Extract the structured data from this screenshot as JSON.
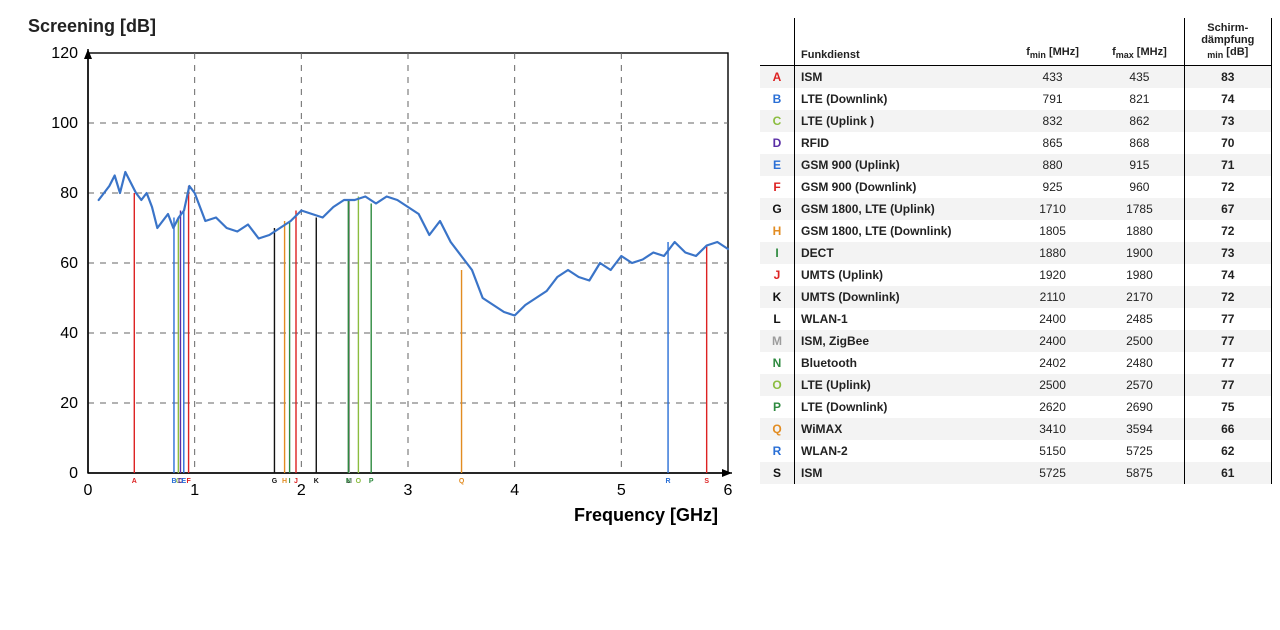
{
  "chart": {
    "y_title": "Screening [dB]",
    "x_title": "Frequency [GHz]",
    "x_min": 0,
    "x_max": 6,
    "y_min": 0,
    "y_max": 120,
    "x_ticks": [
      0,
      1,
      2,
      3,
      4,
      5,
      6
    ],
    "y_ticks": [
      0,
      20,
      40,
      60,
      80,
      100,
      120
    ]
  },
  "chart_data": {
    "type": "line",
    "title": "Screening [dB]",
    "xlabel": "Frequency [GHz]",
    "ylabel": "Screening [dB]",
    "xlim": [
      0,
      6
    ],
    "ylim": [
      0,
      120
    ],
    "series": [
      {
        "name": "Screening",
        "color": "#3a74c8",
        "x": [
          0.1,
          0.15,
          0.2,
          0.25,
          0.3,
          0.35,
          0.4,
          0.45,
          0.5,
          0.55,
          0.6,
          0.65,
          0.7,
          0.75,
          0.8,
          0.85,
          0.9,
          0.95,
          1.0,
          1.1,
          1.2,
          1.3,
          1.4,
          1.5,
          1.6,
          1.7,
          1.8,
          1.9,
          2.0,
          2.1,
          2.2,
          2.3,
          2.4,
          2.5,
          2.6,
          2.7,
          2.8,
          2.9,
          3.0,
          3.1,
          3.2,
          3.3,
          3.4,
          3.5,
          3.6,
          3.7,
          3.8,
          3.9,
          4.0,
          4.1,
          4.2,
          4.3,
          4.4,
          4.5,
          4.6,
          4.7,
          4.8,
          4.9,
          5.0,
          5.1,
          5.2,
          5.3,
          5.4,
          5.5,
          5.6,
          5.7,
          5.8,
          5.9,
          6.0
        ],
        "y": [
          78,
          80,
          82,
          85,
          80,
          86,
          83,
          80,
          78,
          80,
          76,
          70,
          72,
          74,
          70,
          73,
          75,
          82,
          80,
          72,
          73,
          70,
          69,
          71,
          67,
          68,
          70,
          72,
          75,
          74,
          73,
          76,
          78,
          78,
          79,
          77,
          79,
          78,
          76,
          74,
          68,
          72,
          66,
          62,
          58,
          50,
          48,
          46,
          45,
          48,
          50,
          52,
          56,
          58,
          56,
          55,
          60,
          58,
          62,
          60,
          61,
          63,
          62,
          66,
          63,
          62,
          65,
          66,
          64
        ]
      }
    ],
    "markers": [
      {
        "letter": "A",
        "ghz": 0.434,
        "color": "#d22"
      },
      {
        "letter": "B",
        "ghz": 0.806,
        "color": "#2a6fd6"
      },
      {
        "letter": "C",
        "ghz": 0.847,
        "color": "#8bbd3f"
      },
      {
        "letter": "D",
        "ghz": 0.867,
        "color": "#5a2ea6"
      },
      {
        "letter": "E",
        "ghz": 0.898,
        "color": "#2a6fd6"
      },
      {
        "letter": "F",
        "ghz": 0.943,
        "color": "#d22"
      },
      {
        "letter": "G",
        "ghz": 1.748,
        "color": "#111"
      },
      {
        "letter": "H",
        "ghz": 1.843,
        "color": "#e28c21"
      },
      {
        "letter": "I",
        "ghz": 1.89,
        "color": "#2e8a3f"
      },
      {
        "letter": "J",
        "ghz": 1.95,
        "color": "#d22"
      },
      {
        "letter": "K",
        "ghz": 2.14,
        "color": "#111"
      },
      {
        "letter": "L",
        "ghz": 2.443,
        "color": "#111"
      },
      {
        "letter": "M",
        "ghz": 2.45,
        "color": "#9c9c9c"
      },
      {
        "letter": "N",
        "ghz": 2.441,
        "color": "#2e8a3f"
      },
      {
        "letter": "O",
        "ghz": 2.535,
        "color": "#8bbd3f"
      },
      {
        "letter": "P",
        "ghz": 2.655,
        "color": "#2e8a3f"
      },
      {
        "letter": "Q",
        "ghz": 3.502,
        "color": "#e28c21"
      },
      {
        "letter": "R",
        "ghz": 5.438,
        "color": "#2a6fd6"
      },
      {
        "letter": "S",
        "ghz": 5.8,
        "color": "#d22"
      }
    ]
  },
  "table": {
    "headers": {
      "name": "Funkdienst",
      "fmin": "f<sub class=\"sub\">min</sub> [MHz]",
      "fmax": "f<sub class=\"sub\">max</sub> [MHz]",
      "att": "Schirm-<br>dämpfung<br><sub class=\"sub\">min</sub> [dB]"
    },
    "rows": [
      {
        "letter": "A",
        "color": "#d22",
        "name": "ISM",
        "fmin": 433,
        "fmax": 435,
        "att": 83
      },
      {
        "letter": "B",
        "color": "#2a6fd6",
        "name": "LTE (Downlink)",
        "fmin": 791,
        "fmax": 821,
        "att": 74
      },
      {
        "letter": "C",
        "color": "#8bbd3f",
        "name": "LTE (Uplink )",
        "fmin": 832,
        "fmax": 862,
        "att": 73
      },
      {
        "letter": "D",
        "color": "#5a2ea6",
        "name": "RFID",
        "fmin": 865,
        "fmax": 868,
        "att": 70
      },
      {
        "letter": "E",
        "color": "#2a6fd6",
        "name": "GSM 900 (Uplink)",
        "fmin": 880,
        "fmax": 915,
        "att": 71
      },
      {
        "letter": "F",
        "color": "#d22",
        "name": "GSM 900 (Downlink)",
        "fmin": 925,
        "fmax": 960,
        "att": 72
      },
      {
        "letter": "G",
        "color": "#111",
        "name": "GSM 1800, LTE (Uplink)",
        "fmin": 1710,
        "fmax": 1785,
        "att": 67
      },
      {
        "letter": "H",
        "color": "#e28c21",
        "name": "GSM 1800, LTE (Downlink)",
        "fmin": 1805,
        "fmax": 1880,
        "att": 72
      },
      {
        "letter": "I",
        "color": "#2e8a3f",
        "name": "DECT",
        "fmin": 1880,
        "fmax": 1900,
        "att": 73
      },
      {
        "letter": "J",
        "color": "#d22",
        "name": "UMTS (Uplink)",
        "fmin": 1920,
        "fmax": 1980,
        "att": 74
      },
      {
        "letter": "K",
        "color": "#111",
        "name": "UMTS (Downlink)",
        "fmin": 2110,
        "fmax": 2170,
        "att": 72
      },
      {
        "letter": "L",
        "color": "#111",
        "name": "WLAN-1",
        "fmin": 2400,
        "fmax": 2485,
        "att": 77
      },
      {
        "letter": "M",
        "color": "#9c9c9c",
        "name": "ISM, ZigBee",
        "fmin": 2400,
        "fmax": 2500,
        "att": 77
      },
      {
        "letter": "N",
        "color": "#2e8a3f",
        "name": "Bluetooth",
        "fmin": 2402,
        "fmax": 2480,
        "att": 77
      },
      {
        "letter": "O",
        "color": "#8bbd3f",
        "name": "LTE (Uplink)",
        "fmin": 2500,
        "fmax": 2570,
        "att": 77
      },
      {
        "letter": "P",
        "color": "#2e8a3f",
        "name": "LTE (Downlink)",
        "fmin": 2620,
        "fmax": 2690,
        "att": 75
      },
      {
        "letter": "Q",
        "color": "#e28c21",
        "name": "WiMAX",
        "fmin": 3410,
        "fmax": 3594,
        "att": 66
      },
      {
        "letter": "R",
        "color": "#2a6fd6",
        "name": "WLAN-2",
        "fmin": 5150,
        "fmax": 5725,
        "att": 62
      },
      {
        "letter": "S",
        "color": "#111",
        "name": "ISM",
        "fmin": 5725,
        "fmax": 5875,
        "att": 61
      }
    ]
  }
}
